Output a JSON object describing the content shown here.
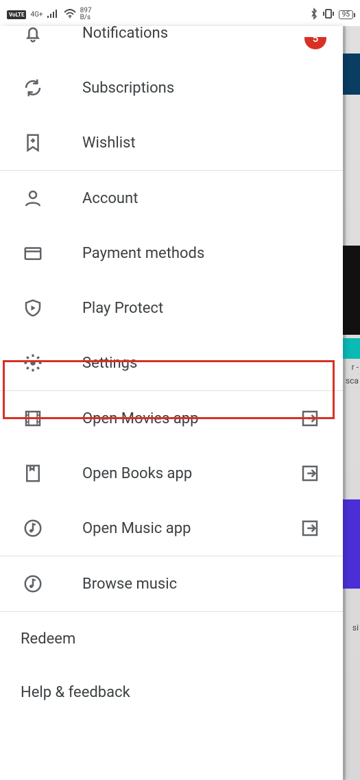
{
  "status_bar": {
    "volte": "VoLTE",
    "network_sub": "4G+",
    "speed_top": "897",
    "speed_bottom": "B/s",
    "battery": "95"
  },
  "drawer": {
    "notifications": {
      "label": "Notifications",
      "badge": "5"
    },
    "subscriptions": {
      "label": "Subscriptions"
    },
    "wishlist": {
      "label": "Wishlist"
    },
    "account": {
      "label": "Account"
    },
    "payment_methods": {
      "label": "Payment methods"
    },
    "play_protect": {
      "label": "Play Protect"
    },
    "settings": {
      "label": "Settings"
    },
    "open_movies": {
      "label": "Open Movies app"
    },
    "open_books": {
      "label": "Open Books app"
    },
    "open_music": {
      "label": "Open Music app"
    },
    "browse_music": {
      "label": "Browse music"
    },
    "redeem": {
      "label": "Redeem"
    },
    "help_feedback": {
      "label": "Help & feedback"
    }
  },
  "bg_text": {
    "r": "r -",
    "sca": "sca",
    "si": "si"
  },
  "highlighted_item": "settings"
}
